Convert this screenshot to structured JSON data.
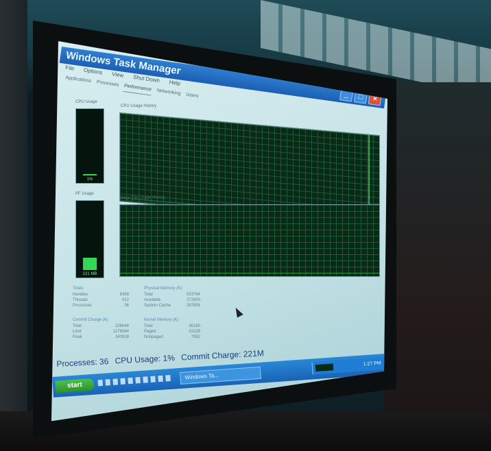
{
  "window": {
    "title": "Windows Task Manager",
    "controls": [
      "_",
      "□",
      "×"
    ]
  },
  "menu": [
    "File",
    "Options",
    "View",
    "Shut Down",
    "Help"
  ],
  "tabs": [
    "Applications",
    "Processes",
    "Performance",
    "Networking",
    "Users"
  ],
  "active_tab": "Performance",
  "performance": {
    "cpu_usage": {
      "label": "CPU Usage",
      "readout": "1%"
    },
    "cpu_history_label": "CPU Usage History",
    "pf_usage": {
      "label": "PF Usage",
      "readout": "221 MB"
    },
    "pf_history_label": "Page File Usage History"
  },
  "stats": {
    "totals": {
      "title": "Totals",
      "rows": [
        [
          "Handles",
          "8458"
        ],
        [
          "Threads",
          "412"
        ],
        [
          "Processes",
          "36"
        ]
      ]
    },
    "physical": {
      "title": "Physical Memory (K)",
      "rows": [
        [
          "Total",
          "523764"
        ],
        [
          "Available",
          "272600"
        ],
        [
          "System Cache",
          "297656"
        ]
      ]
    },
    "commit": {
      "title": "Commit Charge (K)",
      "rows": [
        [
          "Total",
          "226648"
        ],
        [
          "Limit",
          "1279064"
        ],
        [
          "Peak",
          "240928"
        ]
      ]
    },
    "kernel": {
      "title": "Kernel Memory (K)",
      "rows": [
        [
          "Total",
          "30180"
        ],
        [
          "Paged",
          "22228"
        ],
        [
          "Nonpaged",
          "7952"
        ]
      ]
    }
  },
  "status": {
    "processes": "Processes: 36",
    "cpu": "CPU Usage: 1%",
    "commit": "Commit Charge: 221M"
  },
  "taskbar": {
    "start": "start",
    "task": "Windows Ta...",
    "tray_time": "1:27 PM"
  },
  "colors": {
    "graph_bg": "#0a2a18",
    "graph_line": "#45e26a",
    "titlebar": "#2f7fd0",
    "start_green": "#4cc14a"
  }
}
